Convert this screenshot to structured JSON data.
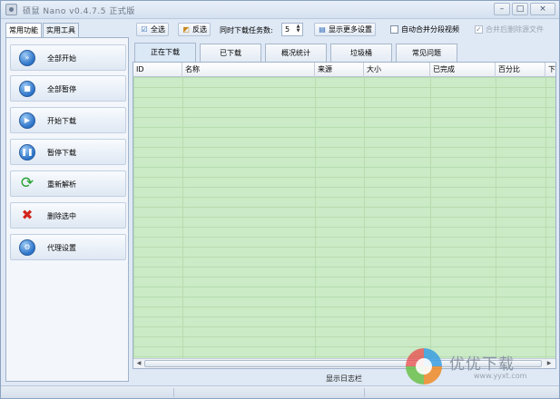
{
  "window": {
    "title": "硕鼠 Nano v0.4.7.5 正式版",
    "controls": [
      "–",
      "□",
      "×"
    ]
  },
  "left_tabs": [
    "常用功能",
    "实用工具"
  ],
  "sidebar": {
    "items": [
      {
        "label": "全部开始",
        "icon": "play-all-icon",
        "glyph": "»"
      },
      {
        "label": "全部暂停",
        "icon": "pause-all-icon",
        "glyph": "■"
      },
      {
        "label": "开始下载",
        "icon": "play-icon",
        "glyph": "▶"
      },
      {
        "label": "暂停下载",
        "icon": "pause-icon",
        "glyph": "❚❚"
      },
      {
        "label": "重新解析",
        "icon": "refresh-icon",
        "glyph": "⟳"
      },
      {
        "label": "删除选中",
        "icon": "delete-icon",
        "glyph": "✖"
      },
      {
        "label": "代理设置",
        "icon": "proxy-settings-icon",
        "glyph": "⚙"
      }
    ]
  },
  "toolbar": {
    "select_all": "全选",
    "invert_select": "反选",
    "concurrent_label": "同时下载任务数:",
    "concurrent_value": "5",
    "more_settings": "显示更多设置",
    "auto_merge_label": "自动合并分段视频",
    "delete_source_label": "合并后删除源文件"
  },
  "main_tabs": [
    "正在下载",
    "已下载",
    "概况统计",
    "垃圾桶",
    "常见问题"
  ],
  "grid": {
    "columns": [
      "ID",
      "名称",
      "来源",
      "大小",
      "已完成",
      "百分比",
      "下"
    ]
  },
  "log_label": "显示日志栏",
  "watermark": {
    "text": "优优下载",
    "url": "www.yyxt.com"
  }
}
